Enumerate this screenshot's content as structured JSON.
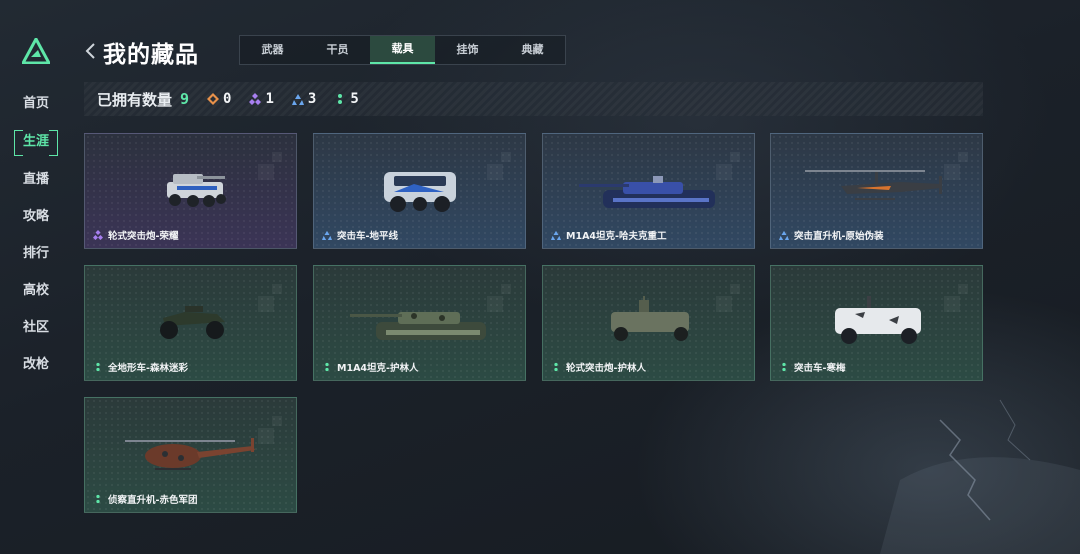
{
  "sidebar": {
    "items": [
      {
        "label": "首页",
        "name": "home"
      },
      {
        "label": "生涯",
        "name": "career",
        "active": true
      },
      {
        "label": "直播",
        "name": "live"
      },
      {
        "label": "攻略",
        "name": "guides"
      },
      {
        "label": "排行",
        "name": "ranking"
      },
      {
        "label": "高校",
        "name": "college"
      },
      {
        "label": "社区",
        "name": "community"
      },
      {
        "label": "改枪",
        "name": "gun-mod"
      }
    ]
  },
  "header": {
    "title": "我的藏品",
    "tabs": [
      {
        "label": "武器",
        "active": false
      },
      {
        "label": "干员",
        "active": false
      },
      {
        "label": "载具",
        "active": true
      },
      {
        "label": "挂饰",
        "active": false
      },
      {
        "label": "典藏",
        "active": false
      }
    ]
  },
  "stats": {
    "label": "已拥有数量",
    "total": "9",
    "counts": [
      {
        "rarity": "orange",
        "value": "0",
        "color": "#e8914a"
      },
      {
        "rarity": "purple",
        "value": "1",
        "color": "#a77ff0"
      },
      {
        "rarity": "blue",
        "value": "3",
        "color": "#6aa6ee"
      },
      {
        "rarity": "green",
        "value": "5",
        "color": "#5ee6a8"
      }
    ]
  },
  "colors": {
    "accent": "#5ee6a8",
    "purple": "#a77ff0",
    "blue": "#6aa6ee",
    "green": "#5ee6a8"
  },
  "items": [
    {
      "name": "轮式突击炮-荣耀",
      "rarity": "purple",
      "vehicle": "wheeled-assault-gun-white"
    },
    {
      "name": "突击车-地平线",
      "rarity": "blue",
      "vehicle": "assault-car-blue"
    },
    {
      "name": "M1A4坦克-哈夫克重工",
      "rarity": "blue",
      "vehicle": "tank-blue"
    },
    {
      "name": "突击直升机-原始伪装",
      "rarity": "blue",
      "vehicle": "attack-helicopter"
    },
    {
      "name": "全地形车-森林迷彩",
      "rarity": "green",
      "vehicle": "atv-camo"
    },
    {
      "name": "M1A4坦克-护林人",
      "rarity": "green",
      "vehicle": "tank-camo"
    },
    {
      "name": "轮式突击炮-护林人",
      "rarity": "green",
      "vehicle": "wheeled-assault-gun-camo"
    },
    {
      "name": "突击车-寒梅",
      "rarity": "green",
      "vehicle": "assault-car-white"
    },
    {
      "name": "侦察直升机-赤色军团",
      "rarity": "green",
      "vehicle": "scout-helicopter-red"
    }
  ]
}
